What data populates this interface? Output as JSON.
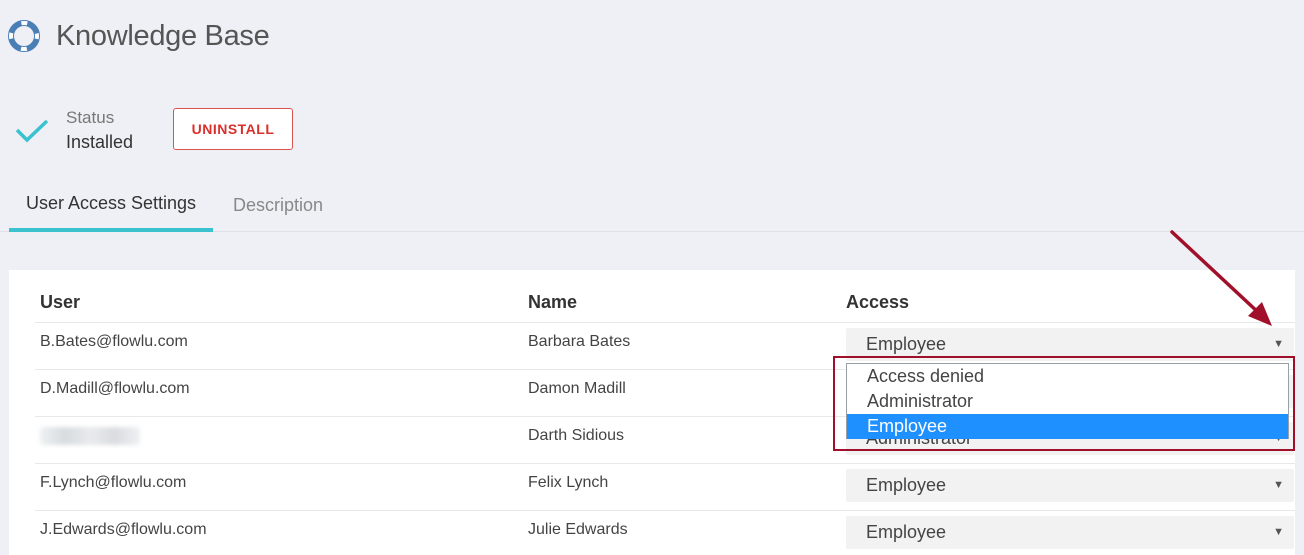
{
  "app": {
    "title": "Knowledge Base",
    "icon": "lifebuoy-icon"
  },
  "status": {
    "label": "Status",
    "value": "Installed",
    "icon": "checkmark-icon"
  },
  "uninstall_label": "UNINSTALL",
  "tabs": [
    {
      "label": "User Access Settings",
      "active": true
    },
    {
      "label": "Description",
      "active": false
    }
  ],
  "table": {
    "headers": {
      "user": "User",
      "name": "Name",
      "access": "Access"
    },
    "rows": [
      {
        "user": "B.Bates@flowlu.com",
        "name": "Barbara Bates",
        "access": "Employee"
      },
      {
        "user": "D.Madill@flowlu.com",
        "name": "Damon Madill",
        "access": ""
      },
      {
        "user": "",
        "name": "Darth Sidious",
        "access": "Administrator"
      },
      {
        "user": "F.Lynch@flowlu.com",
        "name": "Felix Lynch",
        "access": "Employee"
      },
      {
        "user": "J.Edwards@flowlu.com",
        "name": "Julie Edwards",
        "access": "Employee"
      }
    ]
  },
  "dropdown": {
    "options": [
      "Access denied",
      "Administrator",
      "Employee"
    ],
    "selected": "Employee"
  },
  "colors": {
    "accent": "#3cc1cf",
    "danger": "#d9302c",
    "selection": "#1e90ff",
    "annotation": "#a0102a"
  }
}
